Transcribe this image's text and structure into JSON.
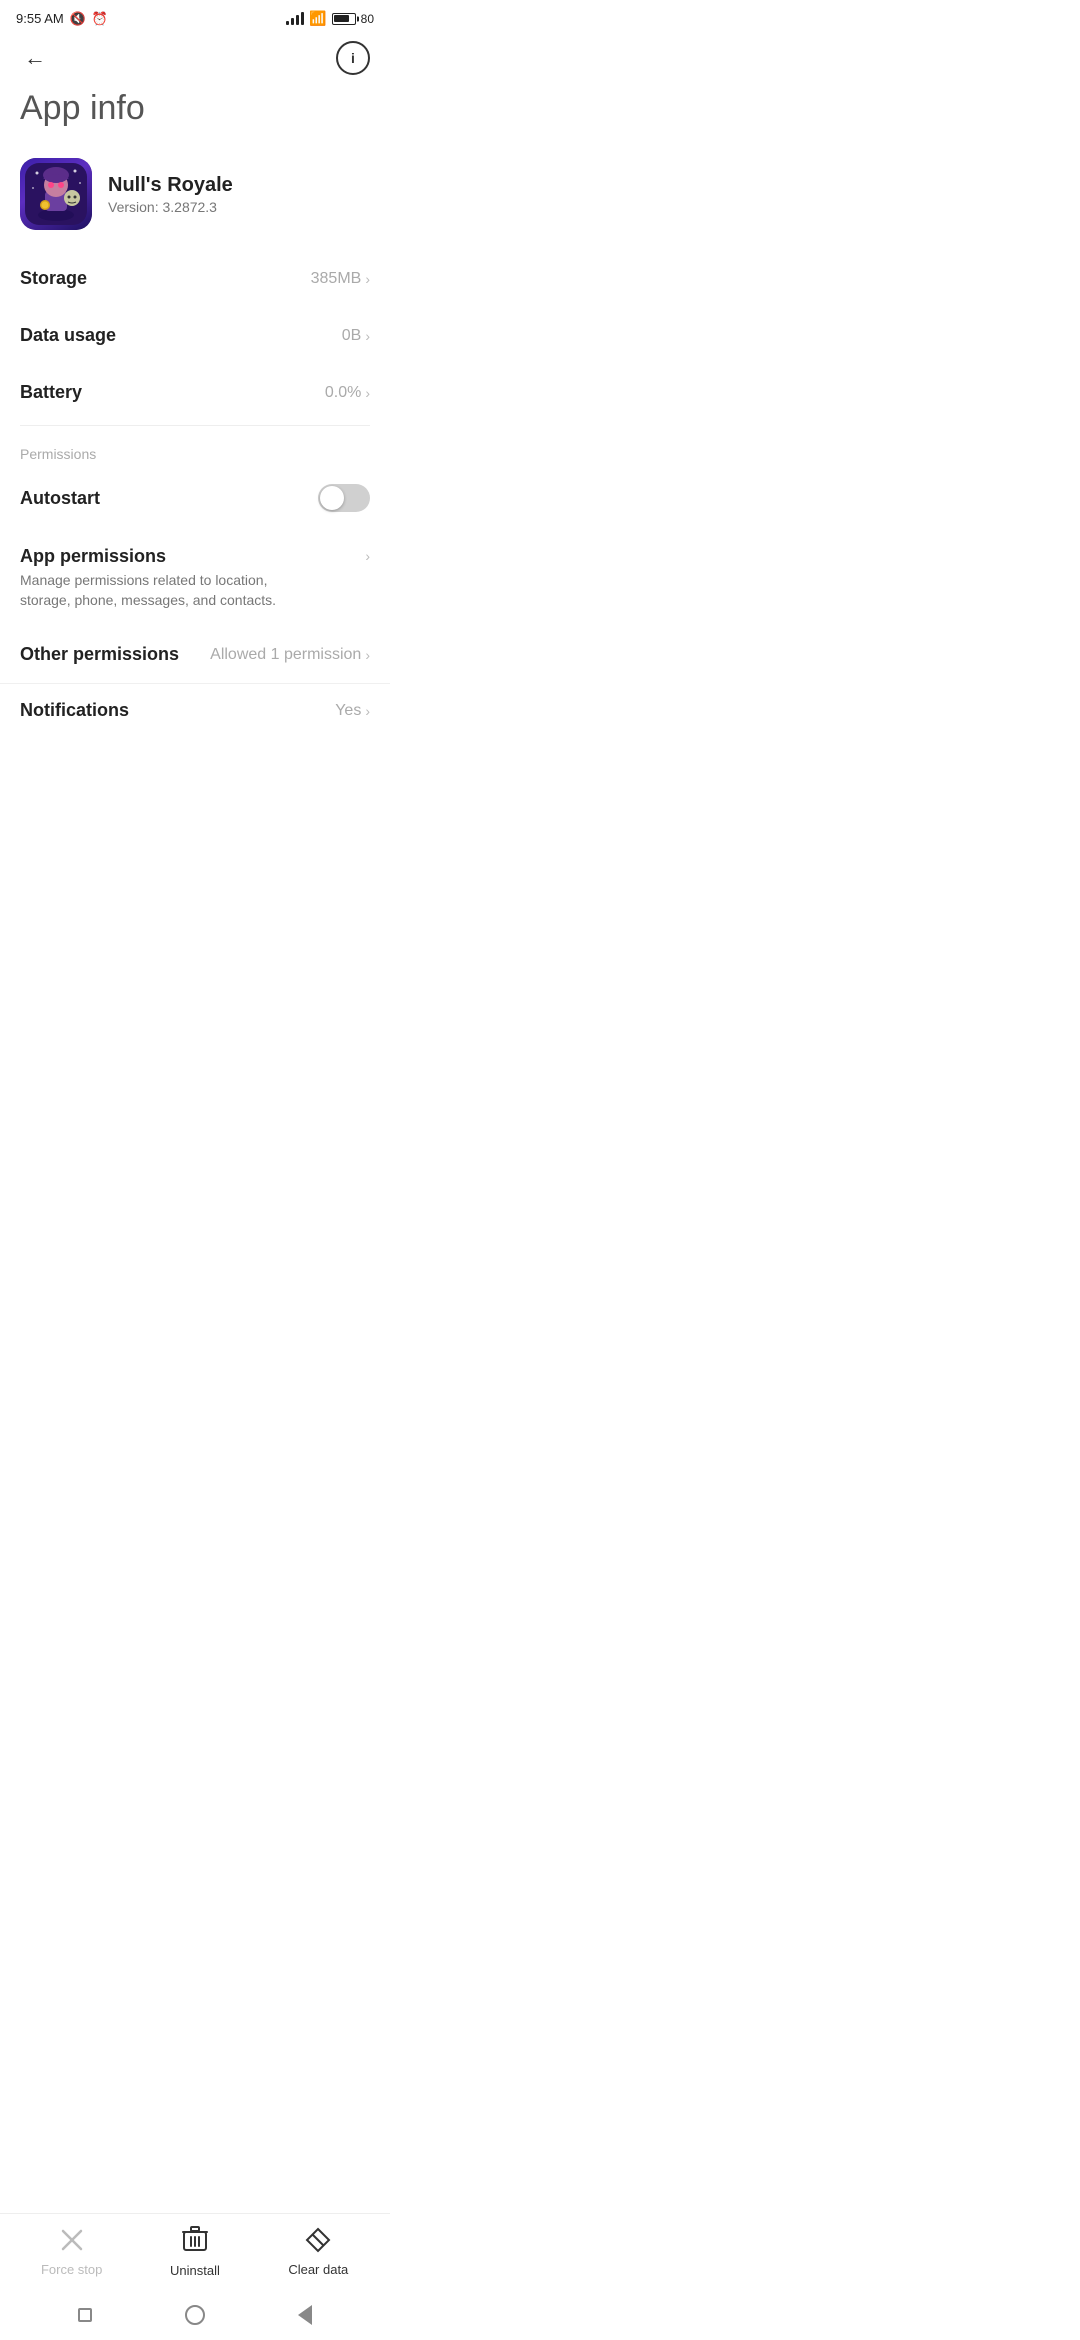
{
  "statusBar": {
    "time": "9:55 AM",
    "battery": "80",
    "batteryPercent": 80
  },
  "nav": {
    "backLabel": "←",
    "infoLabel": "i"
  },
  "pageTitle": "App info",
  "app": {
    "name": "Null's Royale",
    "version": "Version: 3.2872.3"
  },
  "rows": {
    "storage": {
      "label": "Storage",
      "value": "385MB"
    },
    "dataUsage": {
      "label": "Data usage",
      "value": "0B"
    },
    "battery": {
      "label": "Battery",
      "value": "0.0%"
    }
  },
  "permissions": {
    "sectionLabel": "Permissions",
    "autostart": {
      "label": "Autostart",
      "enabled": false
    },
    "appPermissions": {
      "label": "App permissions",
      "description": "Manage permissions related to location, storage, phone, messages, and contacts."
    },
    "otherPermissions": {
      "label": "Other permissions",
      "value": "Allowed 1 permission"
    },
    "notifications": {
      "label": "Notifications",
      "value": "Yes"
    }
  },
  "bottomBar": {
    "forceStop": {
      "label": "Force stop",
      "disabled": true
    },
    "uninstall": {
      "label": "Uninstall",
      "disabled": false
    },
    "clearData": {
      "label": "Clear data",
      "disabled": false
    }
  }
}
